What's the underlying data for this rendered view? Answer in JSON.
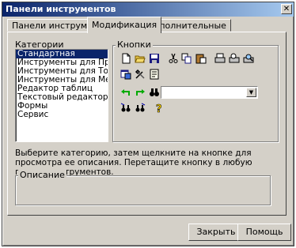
{
  "window": {
    "title": "Панели инструментов"
  },
  "tabs": [
    {
      "label": "Панели инструментов"
    },
    {
      "label": "Модификация"
    },
    {
      "label": "Дополнительные"
    }
  ],
  "categories": {
    "label": "Категории",
    "items": [
      "Стандартная",
      "Инструменты для Продав",
      "Инструменты для Товаро",
      "Инструменты для Менедж",
      "Редактор таблиц",
      "Текстовый редактор",
      "Формы",
      "Сервис"
    ],
    "selected": "Стандартная"
  },
  "buttons_group": {
    "label": "Кнопки",
    "icons": [
      "new-document-icon",
      "open-folder-icon",
      "save-icon",
      "cut-icon",
      "copy-icon",
      "paste-icon",
      "print-icon",
      "print-preview-icon",
      "find-icon",
      "properties-icon",
      "tools-icon",
      "form-icon",
      "undo-icon",
      "redo-icon",
      "binoculars-icon",
      "flag-search-icon",
      "binoculars-icon",
      "help-icon"
    ],
    "combo_value": ""
  },
  "instruction": "Выберите категорию, затем щелкните на кнопке для просмотра ее описания. Перетащите кнопку в любую панель инструментов.",
  "description": {
    "label": "Описание",
    "value": ""
  },
  "footer": {
    "close_label": "Закрыть",
    "help_label": "Помощь"
  },
  "colors": {
    "title_bar": "#0a246a",
    "selection": "#0a246a",
    "face": "#d4d0c8"
  }
}
